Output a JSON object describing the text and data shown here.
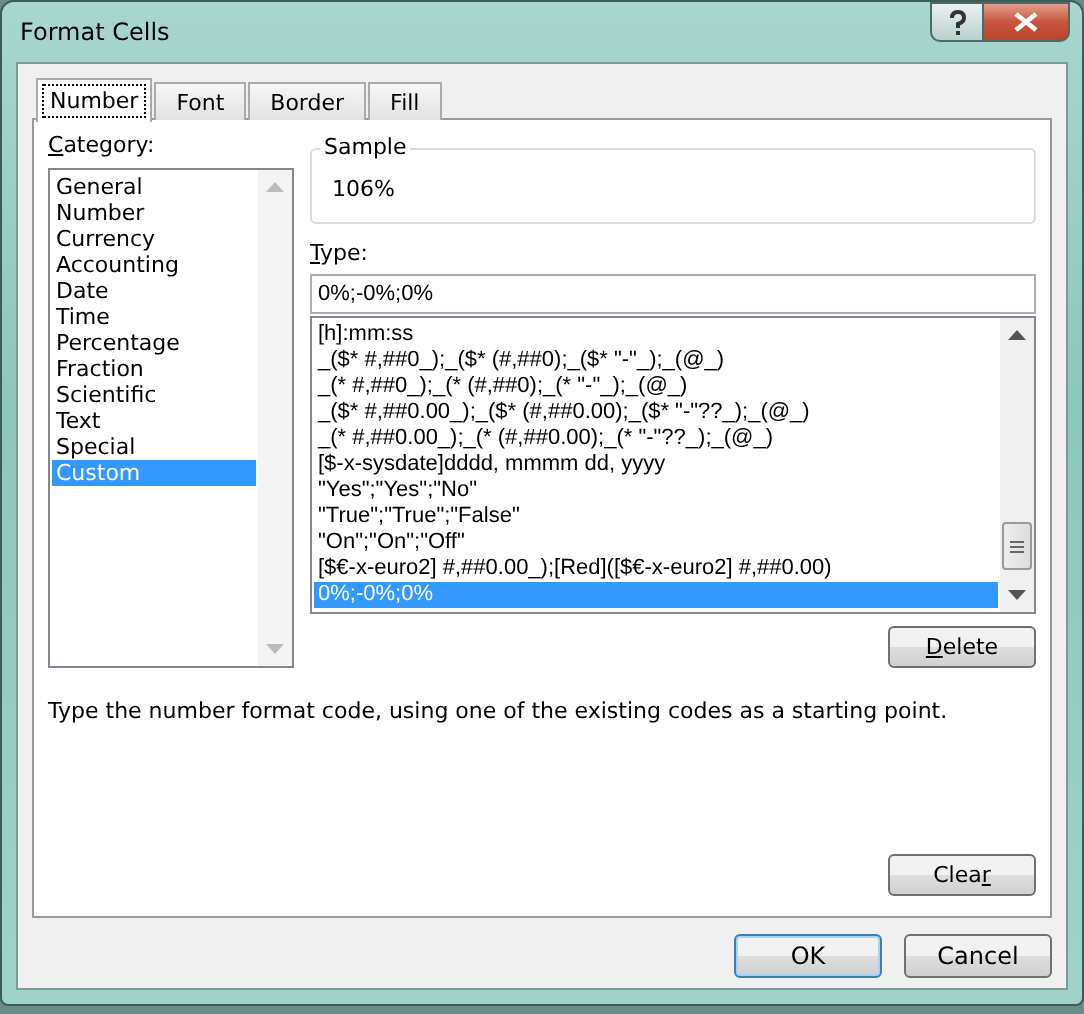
{
  "window": {
    "title": "Format Cells"
  },
  "tabs": [
    {
      "label": "Number",
      "selected": true
    },
    {
      "label": "Font",
      "selected": false
    },
    {
      "label": "Border",
      "selected": false
    },
    {
      "label": "Fill",
      "selected": false
    }
  ],
  "category": {
    "label": {
      "key": "C",
      "rest": "ategory:"
    },
    "items": [
      {
        "label": "General",
        "selected": false
      },
      {
        "label": "Number",
        "selected": false
      },
      {
        "label": "Currency",
        "selected": false
      },
      {
        "label": "Accounting",
        "selected": false
      },
      {
        "label": "Date",
        "selected": false
      },
      {
        "label": "Time",
        "selected": false
      },
      {
        "label": "Percentage",
        "selected": false
      },
      {
        "label": "Fraction",
        "selected": false
      },
      {
        "label": "Scientific",
        "selected": false
      },
      {
        "label": "Text",
        "selected": false
      },
      {
        "label": "Special",
        "selected": false
      },
      {
        "label": "Custom",
        "selected": true
      }
    ]
  },
  "sample": {
    "label": "Sample",
    "value": "106%"
  },
  "type": {
    "label": {
      "key": "T",
      "rest": "ype:"
    },
    "value": "0%;-0%;0%",
    "items": [
      {
        "label": "[h]:mm:ss",
        "selected": false
      },
      {
        "label": "_($* #,##0_);_($* (#,##0);_($* \"-\"_);_(@_)",
        "selected": false
      },
      {
        "label": "_(* #,##0_);_(* (#,##0);_(* \"-\"_);_(@_)",
        "selected": false
      },
      {
        "label": "_($* #,##0.00_);_($* (#,##0.00);_($* \"-\"??_);_(@_)",
        "selected": false
      },
      {
        "label": "_(* #,##0.00_);_(* (#,##0.00);_(* \"-\"??_);_(@_)",
        "selected": false
      },
      {
        "label": "[$-x-sysdate]dddd, mmmm dd, yyyy",
        "selected": false
      },
      {
        "label": "\"Yes\";\"Yes\";\"No\"",
        "selected": false
      },
      {
        "label": "\"True\";\"True\";\"False\"",
        "selected": false
      },
      {
        "label": "\"On\";\"On\";\"Off\"",
        "selected": false
      },
      {
        "label": "[$€-x-euro2] #,##0.00_);[Red]([$€-x-euro2] #,##0.00)",
        "selected": false
      },
      {
        "label": "0%;-0%;0%",
        "selected": true
      }
    ]
  },
  "delete_button": {
    "label": {
      "key": "D",
      "rest": "elete"
    }
  },
  "description": "Type the number format code, using one of the existing codes as a starting point.",
  "clear_button": {
    "label": {
      "pre": "Clea",
      "key": "r"
    }
  },
  "buttons": [
    {
      "label": "OK",
      "kind": "default"
    },
    {
      "label": "Cancel",
      "kind": "normal"
    }
  ]
}
